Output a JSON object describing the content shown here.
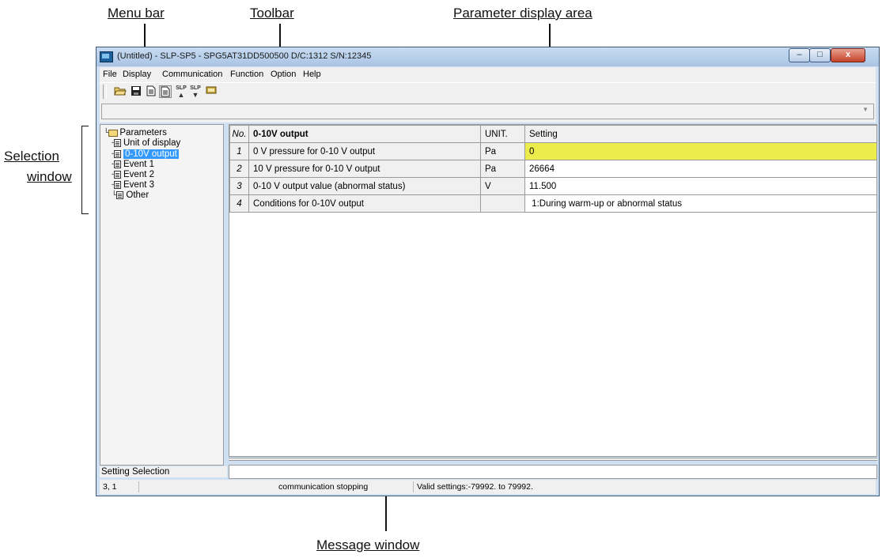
{
  "callouts": {
    "menu_bar": "Menu bar",
    "toolbar": "Toolbar",
    "parameter_display_area": "Parameter display area",
    "selection_window_line1": "Selection",
    "selection_window_line2": "window",
    "message_window": "Message window"
  },
  "window": {
    "title": "(Untitled) - SLP-SP5 - SPG5AT31DD500500 D/C:1312 S/N:12345",
    "icon": "app-icon",
    "buttons": {
      "minimize": "–",
      "maximize": "□",
      "close": "x"
    }
  },
  "menu": [
    "File",
    "Display",
    "Communication",
    "Function",
    "Option",
    "Help"
  ],
  "toolbar": {
    "buttons": [
      "open-folder-icon",
      "save-disk-icon",
      "document-icon",
      "document-active-icon",
      "slp-upload-icon",
      "slp-download-icon",
      "display-icon"
    ],
    "slp_label": "SLP"
  },
  "tree": {
    "root": "Parameters",
    "items": [
      "Unit of display",
      "0-10V output",
      "Event 1",
      "Event 2",
      "Event 3",
      "Other"
    ],
    "selected": "0-10V output"
  },
  "grid": {
    "headers": {
      "no": "No.",
      "item": "0-10V output",
      "unit": "UNIT.",
      "setting": "Setting"
    },
    "rows": [
      {
        "no": "1",
        "item": "0 V pressure for 0-10 V output",
        "unit": "Pa",
        "setting": "0"
      },
      {
        "no": "2",
        "item": "10 V pressure for 0-10 V output",
        "unit": "Pa",
        "setting": "26664"
      },
      {
        "no": "3",
        "item": "0-10 V output value (abnormal status)",
        "unit": "V",
        "setting": "11.500"
      },
      {
        "no": "4",
        "item": "Conditions for 0-10V output",
        "unit": "",
        "setting": " 1:During warm-up or abnormal status"
      }
    ]
  },
  "message": {
    "label": "Setting Selection",
    "text": ""
  },
  "status": {
    "position": "3, 1",
    "blank": "",
    "comm": "communication stopping",
    "valid": "Valid settings:-79992. to 79992."
  }
}
